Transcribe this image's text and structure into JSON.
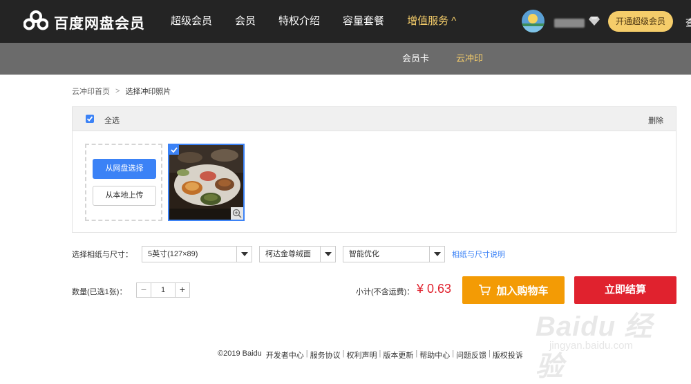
{
  "header": {
    "brand": "百度网盘会员",
    "nav": [
      {
        "label": "超级会员",
        "active": false
      },
      {
        "label": "会员",
        "active": false
      },
      {
        "label": "特权介绍",
        "active": false
      },
      {
        "label": "容量套餐",
        "active": false
      },
      {
        "label": "增值服务 ^",
        "active": true
      }
    ],
    "vip_button": "开通超级会员",
    "cut_text": "查",
    "accent_color": "#f5cd6a"
  },
  "subnav": {
    "items": [
      {
        "label": "会员卡",
        "active": false
      },
      {
        "label": "云冲印",
        "active": true
      }
    ]
  },
  "breadcrumb": {
    "home": "云冲印首页",
    "separator": ">",
    "current": "选择冲印照片"
  },
  "panel": {
    "select_all": "全选",
    "select_all_checked": true,
    "delete": "删除",
    "upload_from_netdisk": "从网盘选择",
    "upload_from_local": "从本地上传",
    "photo_selected": true
  },
  "options": {
    "label": "选择相纸与尺寸：",
    "size_select": "5英寸(127×89)",
    "paper_select": "柯达金尊绒面",
    "enhance_select": "智能优化",
    "help_link": "相纸与尺寸说明"
  },
  "quantity": {
    "label": "数量(已选1张)：",
    "minus": "−",
    "value": "1",
    "plus": "+"
  },
  "summary": {
    "subtotal_label": "小计(不含运费)：",
    "price": "¥ 0.63",
    "add_to_cart": "加入购物车",
    "checkout": "立即结算",
    "cart_color": "#f39b05",
    "checkout_color": "#e0222e"
  },
  "footer": {
    "copyright": "©2019 Baidu",
    "links": [
      "开发者中心",
      "服务协议",
      "权利声明",
      "版本更新",
      "帮助中心",
      "问题反馈",
      "版权投诉"
    ]
  },
  "watermark": {
    "main": "Baidu 经验",
    "sub": "jingyan.baidu.com"
  }
}
